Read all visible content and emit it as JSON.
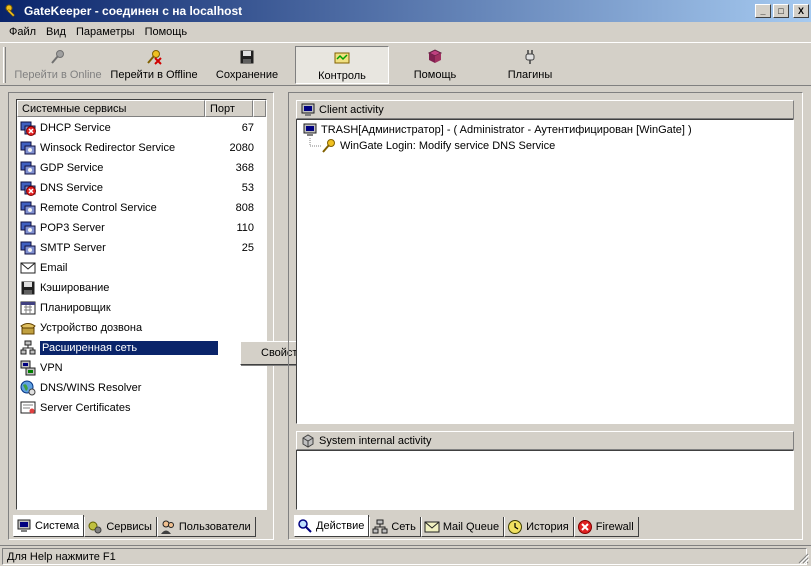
{
  "window": {
    "title": "GateKeeper - соединен с на localhost",
    "min_label": "_",
    "max_label": "□",
    "close_label": "X"
  },
  "menu": {
    "items": [
      {
        "label": "Файл"
      },
      {
        "label": "Вид"
      },
      {
        "label": "Параметры"
      },
      {
        "label": "Помощь"
      }
    ]
  },
  "toolbar": {
    "buttons": [
      {
        "label": "Перейти в Online",
        "icon": "key-icon"
      },
      {
        "label": "Перейти в Offline",
        "icon": "key-x-icon"
      },
      {
        "label": "Сохранение",
        "icon": "floppy-icon"
      },
      {
        "label": "Контроль",
        "icon": "monitor-icon"
      },
      {
        "label": "Помощь",
        "icon": "book-icon"
      },
      {
        "label": "Плагины",
        "icon": "plug-icon"
      }
    ]
  },
  "services": {
    "col_name": "Системные сервисы",
    "col_port": "Порт",
    "rows": [
      {
        "name": "DHCP Service",
        "port": "67",
        "icon": "service-stopped-icon"
      },
      {
        "name": "Winsock Redirector Service",
        "port": "2080",
        "icon": "service-icon"
      },
      {
        "name": "GDP Service",
        "port": "368",
        "icon": "service-icon"
      },
      {
        "name": "DNS Service",
        "port": "53",
        "icon": "service-stopped-icon"
      },
      {
        "name": "Remote Control Service",
        "port": "808",
        "icon": "service-icon"
      },
      {
        "name": "POP3 Server",
        "port": "110",
        "icon": "service-icon"
      },
      {
        "name": "SMTP Server",
        "port": "25",
        "icon": "service-icon"
      },
      {
        "name": "Email",
        "port": "",
        "icon": "envelope-icon"
      },
      {
        "name": "Кэширование",
        "port": "",
        "icon": "floppy-icon"
      },
      {
        "name": "Планировщик",
        "port": "",
        "icon": "calendar-icon"
      },
      {
        "name": "Устройство дозвона",
        "port": "",
        "icon": "phone-icon"
      },
      {
        "name": "Расширенная сеть",
        "port": "",
        "icon": "network-icon"
      },
      {
        "name": "VPN",
        "port": "",
        "icon": "vpn-icon"
      },
      {
        "name": "DNS/WINS Resolver",
        "port": "",
        "icon": "globe-icon"
      },
      {
        "name": "Server Certificates",
        "port": "",
        "icon": "certificate-icon"
      }
    ]
  },
  "context_menu": {
    "item": "Свойства"
  },
  "client_activity": {
    "header": "Client activity",
    "entry": "TRASH[Администратор]  -  ( Administrator  -  Аутентифицирован [WinGate] )",
    "child": "WinGate Login: Modify service DNS Service"
  },
  "system_activity": {
    "header": "System internal activity"
  },
  "left_tabs": [
    {
      "label": "Система",
      "icon": "computer-icon"
    },
    {
      "label": "Сервисы",
      "icon": "gears-icon"
    },
    {
      "label": "Пользователи",
      "icon": "users-icon"
    }
  ],
  "right_tabs": [
    {
      "label": "Действие",
      "icon": "search-icon"
    },
    {
      "label": "Сеть",
      "icon": "network-icon"
    },
    {
      "label": "Mail Queue",
      "icon": "envelope-icon"
    },
    {
      "label": "История",
      "icon": "clock-icon"
    },
    {
      "label": "Firewall",
      "icon": "stop-icon"
    }
  ],
  "status": {
    "text": "Для Help нажмите F1"
  }
}
